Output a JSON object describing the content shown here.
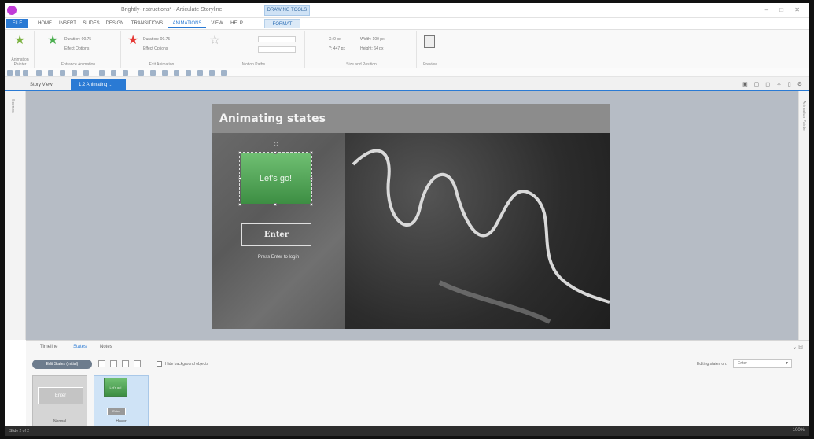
{
  "app": {
    "doc_title": "Brightly-Instructions* - Articulate Storyline",
    "context_tab": "DRAWING TOOLS"
  },
  "ribbon_tabs": {
    "file": "FILE",
    "tabs": [
      "HOME",
      "INSERT",
      "SLIDES",
      "DESIGN",
      "TRANSITIONS",
      "ANIMATIONS",
      "VIEW",
      "HELP"
    ],
    "format": "FORMAT"
  },
  "ribbon": {
    "groups": [
      "Animation Painter",
      "Entrance Animation",
      "Exit Animation",
      "Motion Paths",
      "Size and Position",
      "Preview"
    ],
    "entrance_duration": "Duration: 00.75",
    "exit_duration": "Duration: 00.75",
    "effect_options": "Effect Options",
    "width": "Width: 100 px",
    "height": "Height: 64 px",
    "x_pos": "X: 0 px",
    "y_pos": "Y: 447 px"
  },
  "doctabs": {
    "story_view": "Story View",
    "active": "1.2 Animating ..."
  },
  "left_rail_label": "Scenes",
  "right_rail_label": "Animation Painter",
  "slide": {
    "title": "Animating states",
    "green_button": "Let's go!",
    "enter_button": "Enter",
    "hint": "Press Enter to login"
  },
  "states": {
    "tabs": [
      "Timeline",
      "States",
      "Notes"
    ],
    "active_tab": "States",
    "state_pill": "Edit States (Initial)",
    "hide_background_label": "Hide background objects",
    "editing_label": "Editing states on:",
    "editing_value": "Enter",
    "thumbs": [
      {
        "name": "Normal",
        "inner": "Enter"
      },
      {
        "name": "Hover",
        "inner": "Let's go!",
        "inner2": "Enter"
      }
    ]
  },
  "status": {
    "left": "Slide 2 of 2",
    "right": "100%"
  },
  "colors": {
    "accent": "#2a7ad4",
    "button_green": "#4c9f50",
    "canvas_bg": "#b6bcc5"
  }
}
